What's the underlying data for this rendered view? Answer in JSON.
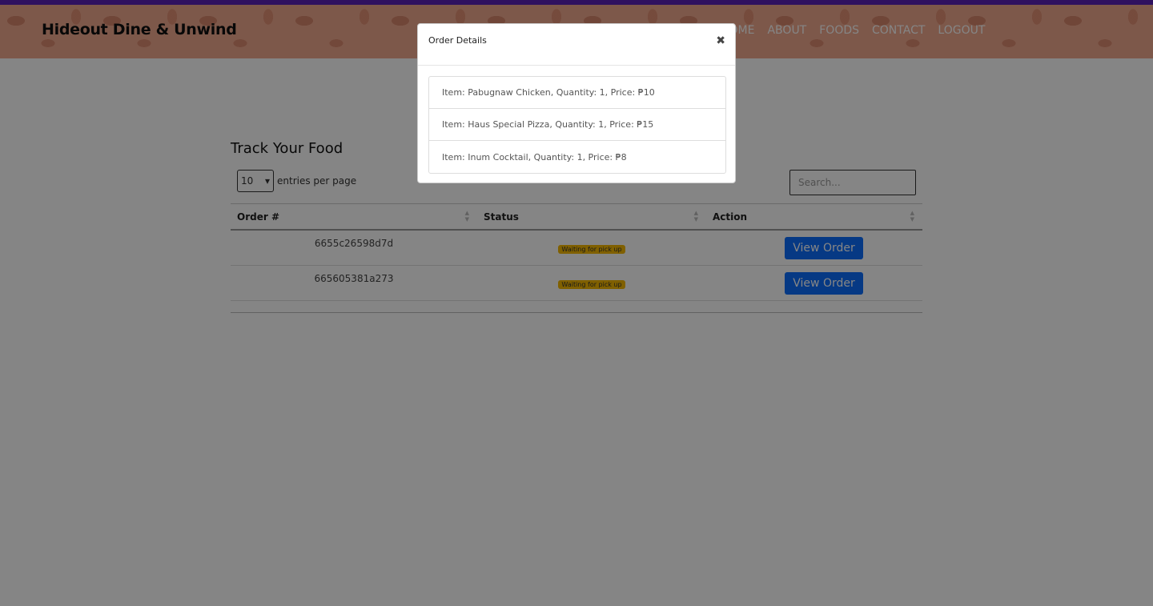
{
  "header": {
    "brand": "Hideout Dine & Unwind",
    "nav": [
      "HOME",
      "ABOUT",
      "FOODS",
      "CONTACT",
      "LOGOUT"
    ]
  },
  "main": {
    "title": "Track Your Food",
    "entries_value": "10",
    "entries_label": "entries per page",
    "search_placeholder": "Search...",
    "columns": [
      "Order #",
      "Status",
      "Action"
    ],
    "rows": [
      {
        "order": "6655c26598d7d",
        "status": "Waiting for pick up",
        "action": "View Order"
      },
      {
        "order": "665605381a273",
        "status": "Waiting for pick up",
        "action": "View Order"
      }
    ]
  },
  "modal": {
    "title": "Order Details",
    "close": "✖",
    "items": [
      "Item: Pabugnaw Chicken, Quantity: 1, Price: ₱10",
      "Item: Haus Special Pizza, Quantity: 1, Price: ₱15",
      "Item: Inum Cocktail, Quantity: 1, Price: ₱8"
    ]
  },
  "colors": {
    "accent_bar": "#5b21b6",
    "header_bg": "#f0a98f",
    "button": "#0d6efd",
    "badge": "#f5b800"
  }
}
